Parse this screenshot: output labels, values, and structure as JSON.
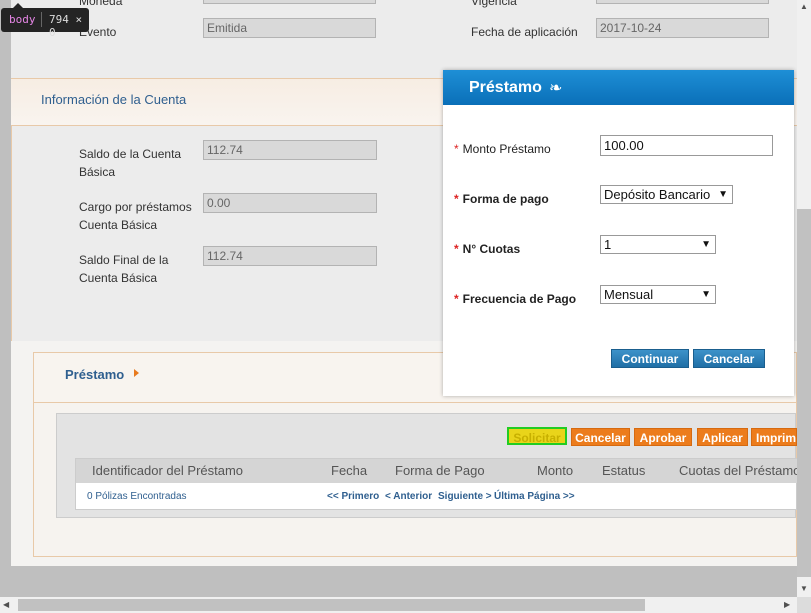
{
  "devtools_tag": {
    "element": "body",
    "size": "794 × 0"
  },
  "top_section": {
    "moneda_label": "Moneda",
    "vigencia_label": "Vigencia",
    "evento_label": "Evento",
    "evento_value": "Emitida",
    "fecha_label": "Fecha de aplicación",
    "fecha_value": "2017-10-24"
  },
  "account_section": {
    "title": "Información de la Cuenta",
    "saldo_label": "Saldo de la Cuenta Básica",
    "saldo_value": "112.74",
    "cargo_label": "Cargo por préstamos Cuenta Básica",
    "cargo_value": "0.00",
    "saldo_final_label": "Saldo Final de la Cuenta Básica",
    "saldo_final_value": "112.74"
  },
  "prestamo_panel": {
    "title": "Préstamo",
    "buttons": {
      "solicitar": "Solicitar",
      "cancelar": "Cancelar",
      "aprobar": "Aprobar",
      "aplicar": "Aplicar",
      "imprimir": "Imprimir"
    },
    "table": {
      "columns": [
        "Identificador del Préstamo",
        "Fecha",
        "Forma de Pago",
        "Monto",
        "Estatus",
        "Cuotas del Préstamo"
      ],
      "empty_text": "0 Pólizas Encontradas",
      "pager_first": "<< Primero",
      "pager_prev": "< Anterior",
      "pager_next": "Siguiente >",
      "pager_last": "Última Página >>"
    }
  },
  "modal": {
    "title": "Préstamo",
    "monto_label": "Monto Préstamo",
    "monto_value": "100.00",
    "forma_label": "Forma de pago",
    "forma_value": "Depósito Bancario",
    "cuotas_label": "N° Cuotas",
    "cuotas_value": "1",
    "frecuencia_label": "Frecuencia de Pago",
    "frecuencia_value": "Mensual",
    "continuar_label": "Continuar",
    "cancelar_label": "Cancelar"
  }
}
